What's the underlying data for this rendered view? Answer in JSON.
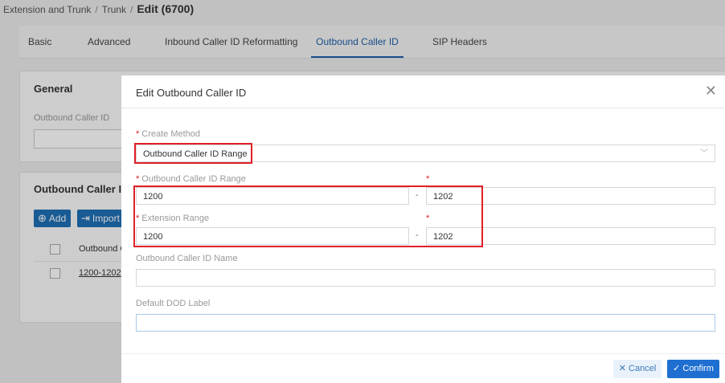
{
  "breadcrumb": {
    "items": [
      "Extension and Trunk",
      "Trunk"
    ],
    "current": "Edit (6700)"
  },
  "tabs": [
    {
      "label": "Basic"
    },
    {
      "label": "Advanced"
    },
    {
      "label": "Inbound Caller ID Reformatting"
    },
    {
      "label": "Outbound Caller ID"
    },
    {
      "label": "SIP Headers"
    }
  ],
  "active_tab": "Outbound Caller ID",
  "general": {
    "title": "General",
    "field_label": "Outbound Caller ID"
  },
  "outbound_list": {
    "title": "Outbound Caller ID",
    "add_label": "Add",
    "import_label": "Import",
    "column_header": "Outbound C",
    "rows": [
      {
        "value": "1200-1202"
      }
    ]
  },
  "modal": {
    "title": "Edit Outbound Caller ID",
    "create_method": {
      "label": "Create Method",
      "value": "Outbound Caller ID Range"
    },
    "caller_id_range": {
      "label": "Outbound Caller ID Range",
      "from": "1200",
      "to": "1202"
    },
    "extension_range": {
      "label": "Extension Range",
      "from": "1200",
      "to": "1202"
    },
    "caller_id_name": {
      "label": "Outbound Caller ID Name",
      "value": ""
    },
    "dod_label": {
      "label": "Default DOD Label",
      "value": ""
    },
    "required_mark": "*",
    "range_separator": "-",
    "cancel_label": "Cancel",
    "confirm_label": "Confirm"
  },
  "colors": {
    "accent": "#1f6fd1",
    "highlight": "#e0202a",
    "required": "#e02020"
  }
}
